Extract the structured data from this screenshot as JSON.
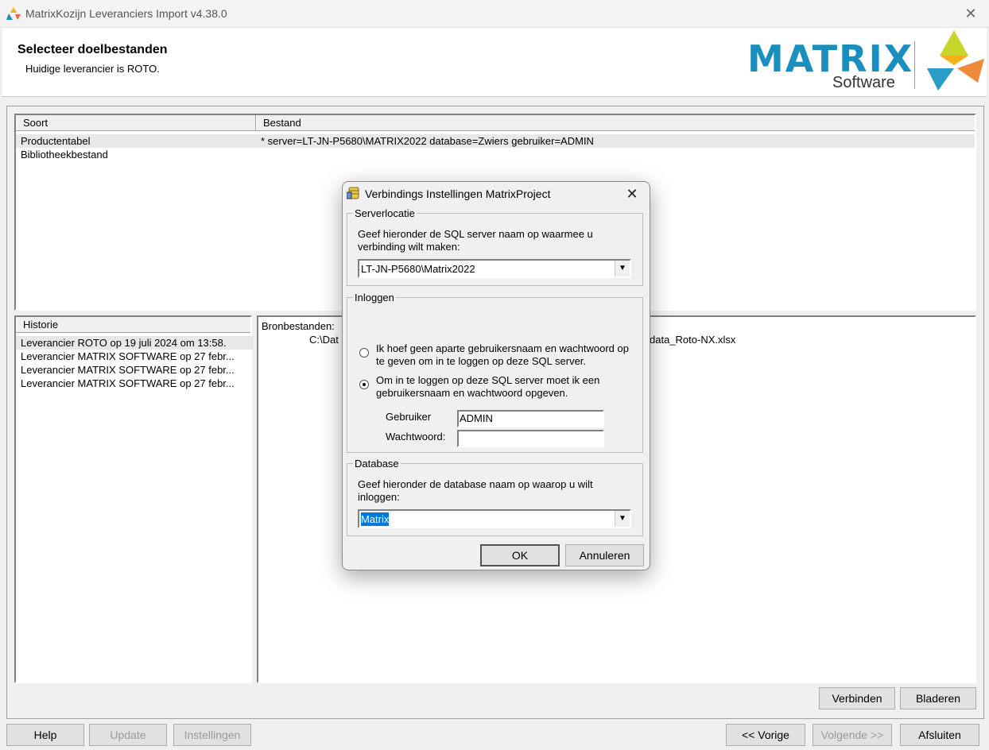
{
  "window": {
    "title": "MatrixKozijn Leveranciers Import v4.38.0",
    "close_glyph": "✕"
  },
  "header": {
    "title": "Selecteer doelbestanden",
    "subtitle": "Huidige leverancier is ROTO.",
    "logo_text": "MATRIX",
    "logo_subtext": "Software"
  },
  "files_table": {
    "columns": [
      "Soort",
      "Bestand"
    ],
    "rows": [
      {
        "soort": "Productentabel",
        "bestand": "* server=LT-JN-P5680\\MATRIX2022  database=Zwiers  gebruiker=ADMIN"
      },
      {
        "soort": "Bibliotheekbestand",
        "bestand": ""
      }
    ]
  },
  "history": {
    "header": "Historie",
    "items": [
      "Leverancier ROTO op  19 juli 2024  om 13:58.",
      "Leverancier MATRIX SOFTWARE op  27 febr...",
      "Leverancier MATRIX SOFTWARE op  27 febr...",
      "Leverancier MATRIX SOFTWARE op  27 febr..."
    ]
  },
  "details": {
    "label": "Bronbestanden:",
    "path_start": "C:\\Dat",
    "path_end": "data_Roto-NX.xlsx"
  },
  "panel_buttons": {
    "connect": "Verbinden",
    "browse": "Bladeren"
  },
  "footer": {
    "help": "Help",
    "update": "Update",
    "settings": "Instellingen",
    "previous": "<< Vorige",
    "next": "Volgende >>",
    "close": "Afsluiten"
  },
  "dialog": {
    "title": "Verbindings Instellingen MatrixProject",
    "server_group": "Serverlocatie",
    "server_text": "Geef hieronder de SQL server naam op waarmee u verbinding wilt maken:",
    "server_value": "LT-JN-P5680\\Matrix2022",
    "login_group": "Inloggen",
    "option_windows": "Ik hoef geen aparte gebruikersnaam en wachtwoord op te geven om in te loggen op deze SQL server.",
    "option_sql": "Om in te loggen op deze SQL server moet ik een gebruikersnaam en wachtwoord opgeven.",
    "user_label": "Gebruiker",
    "user_value": "ADMIN",
    "password_label": "Wachtwoord:",
    "password_value": "",
    "database_group": "Database",
    "database_text": "Geef hieronder de database naam op waarop u wilt inloggen:",
    "database_value": "Matrix",
    "ok": "OK",
    "cancel": "Annuleren"
  }
}
